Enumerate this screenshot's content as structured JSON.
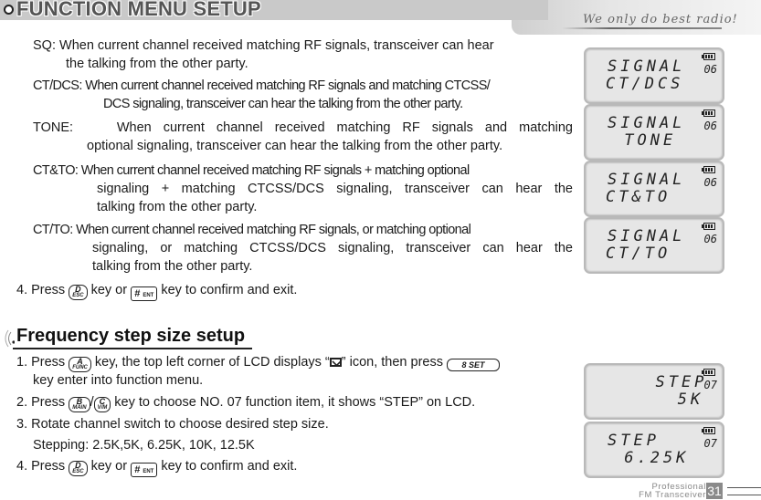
{
  "header": {
    "title": "FUNCTION MENU SETUP",
    "slogan": "We only do best radio!"
  },
  "modes": [
    {
      "label": "SQ:",
      "text": "When current channel received matching RF signals, transceiver can hear",
      "cont": "the talking from the other party."
    },
    {
      "label": "CT/DCS:",
      "text": "When current channel received matching RF signals and matching CTCSS/",
      "cont": "DCS signaling, transceiver can hear the talking from the other party."
    },
    {
      "label": "TONE:",
      "text": "When current channel received matching RF signals and matching",
      "cont": "optional signaling, transceiver can hear the talking from the other party."
    },
    {
      "label": "CT&TO:",
      "text": "When current channel received matching RF signals + matching optional",
      "cont": "signaling + matching CTCSS/DCS signaling, transceiver can hear the",
      "cont2": "talking from the other party."
    },
    {
      "label": "CT/TO:",
      "text": "When current channel received matching RF signals, or matching optional",
      "cont": "signaling, or matching CTCSS/DCS signaling, transceiver can hear the",
      "cont2": "talking from the other party."
    }
  ],
  "step4_top": {
    "num": "4. Press",
    "mid": "key or",
    "end": "key to confirm and exit."
  },
  "keys": {
    "esc": {
      "top": "D",
      "bot": "ESC"
    },
    "ent": {
      "top": "#",
      "bot": "ENT"
    },
    "func": {
      "top": "A",
      "bot": "FUNC"
    },
    "main": {
      "top": "B",
      "bot": "MAIN"
    },
    "vm": {
      "top": "C",
      "bot": "V/M"
    },
    "set": "8 SET"
  },
  "section": {
    "title": "Frequency step size setup",
    "steps": [
      {
        "a": "1. Press",
        "b": "key, the top left corner of LCD displays “",
        "c": "” icon, then press",
        "d": "key enter into function menu."
      },
      {
        "a": "2. Press",
        "sep": "/",
        "b": "key to choose NO. 07 function item, it shows “STEP” on LCD."
      },
      {
        "a": "3. Rotate channel switch to choose desired step size.",
        "b": "Stepping:  2.5K,5K, 6.25K, 10K, 12.5K"
      },
      {
        "a": "4. Press",
        "b": "key or",
        "c": "key to confirm and exit."
      }
    ]
  },
  "lcds": [
    {
      "line1": "SIGNAL",
      "line2": "CT/DCS",
      "num": "06"
    },
    {
      "line1": "SIGNAL",
      "line2": " TONE",
      "num": "06"
    },
    {
      "line1": "SIGNAL",
      "line2": "CT&TO",
      "num": "06"
    },
    {
      "line1": "SIGNAL",
      "line2": "CT/TO",
      "num": "06"
    },
    {
      "line1": "  STEP",
      "line2": "   5K",
      "num": "07"
    },
    {
      "line1": "STEP",
      "line2": " 6.25K",
      "num": "07"
    }
  ],
  "footer": {
    "line1": "Professional",
    "line2": "FM Transceiver",
    "page": "31"
  }
}
